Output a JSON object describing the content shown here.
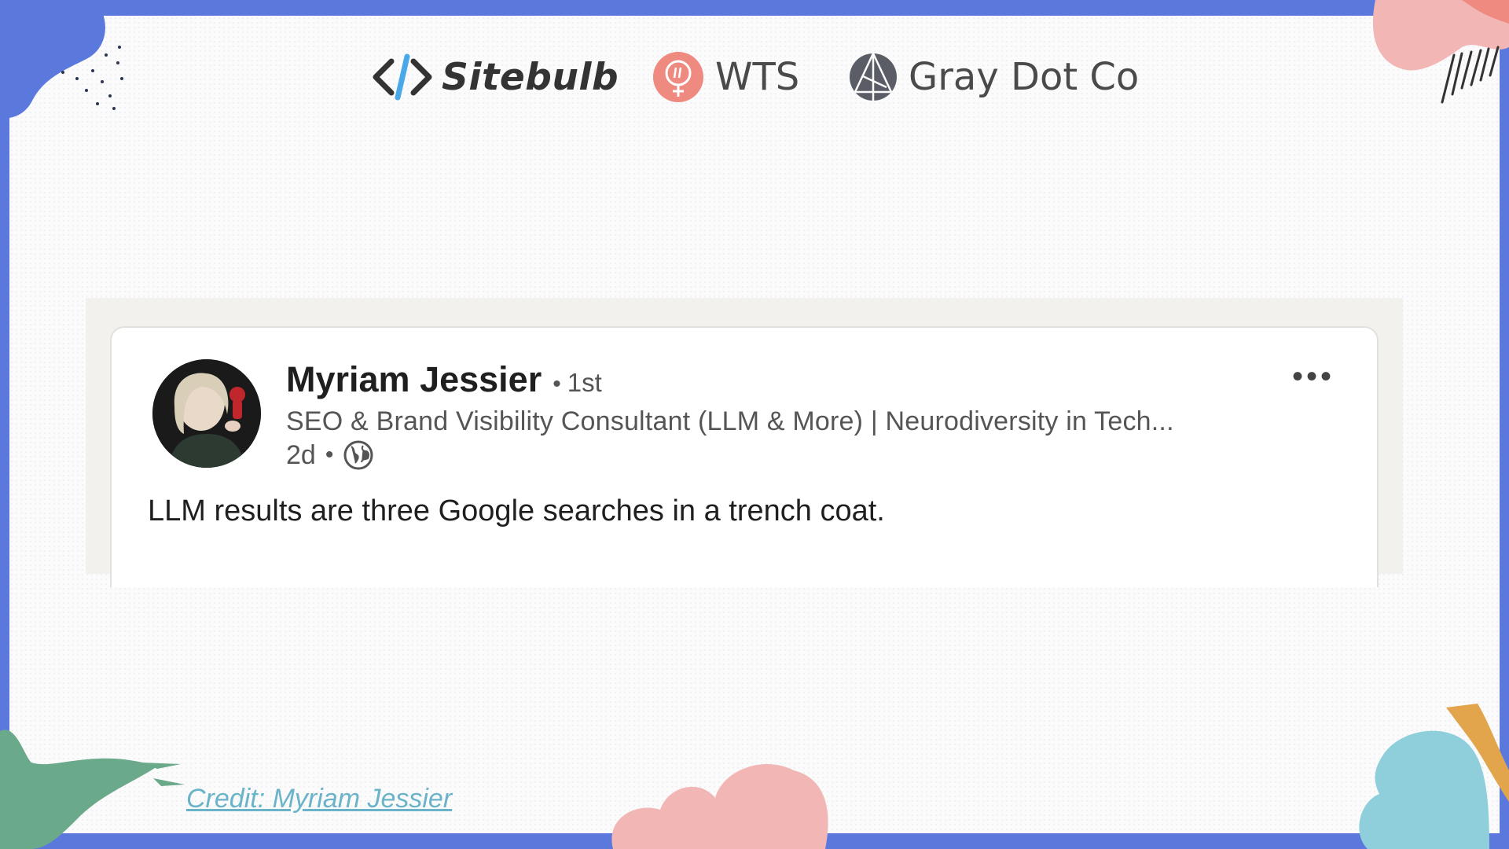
{
  "logos": {
    "sitebulb": "Sitebulb",
    "wts": "WTS",
    "graydot": "Gray Dot Co"
  },
  "post": {
    "author_name": "Myriam Jessier",
    "separator": "•",
    "connection_degree": "1st",
    "headline": "SEO & Brand Visibility Consultant (LLM & More) | Neurodiversity in Tech...",
    "time_ago": "2d",
    "visibility_icon": "globe-icon",
    "more_label": "•••",
    "text": "LLM results are three Google searches in a trench coat."
  },
  "credit": {
    "label": "Credit: Myriam Jessier"
  },
  "colors": {
    "border_blue": "#5b79dd",
    "credit_link": "#6ab3c8",
    "wts_red": "#ee8a80",
    "blob_pink": "#f2b7b5",
    "blob_green": "#6aa98a",
    "blob_teal": "#8fcfdc",
    "blob_orange": "#e2a54c"
  }
}
